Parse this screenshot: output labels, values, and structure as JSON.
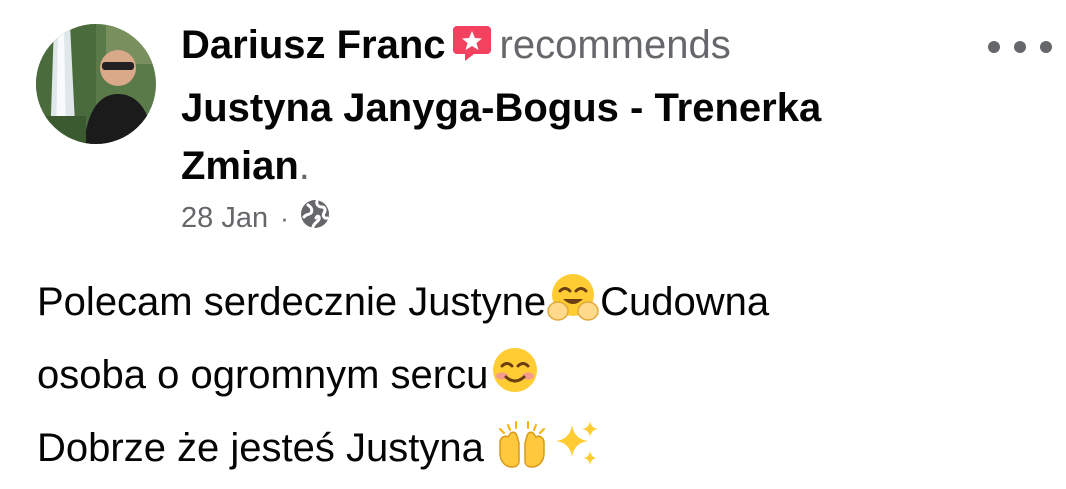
{
  "post": {
    "author_name": "Dariusz Franc",
    "action": "recommends",
    "page_name": "Justyna Janyga-Bogus - Trenerka Zmian",
    "period": ".",
    "date": "28 Jan",
    "separator": "·",
    "privacy_icon": "globe-icon",
    "recommend_icon": "recommendation-star-icon",
    "more_icon": "more-options-icon",
    "body": {
      "line1_text": "Polecam serdecznie Justyne",
      "line1_emoji": "hugging-face-emoji",
      "line1_tail": "Cudowna",
      "line2_text": "osoba o ogromnym sercu",
      "line2_emoji": "smiling-face-emoji",
      "line3_text": "Dobrze że jesteś Justyna ",
      "line3_emojis": [
        "raising-hands-emoji",
        "sparkles-emoji"
      ]
    }
  },
  "colors": {
    "primary_text": "#050505",
    "secondary_text": "#65676b",
    "recommend_badge": "#f3425f"
  }
}
